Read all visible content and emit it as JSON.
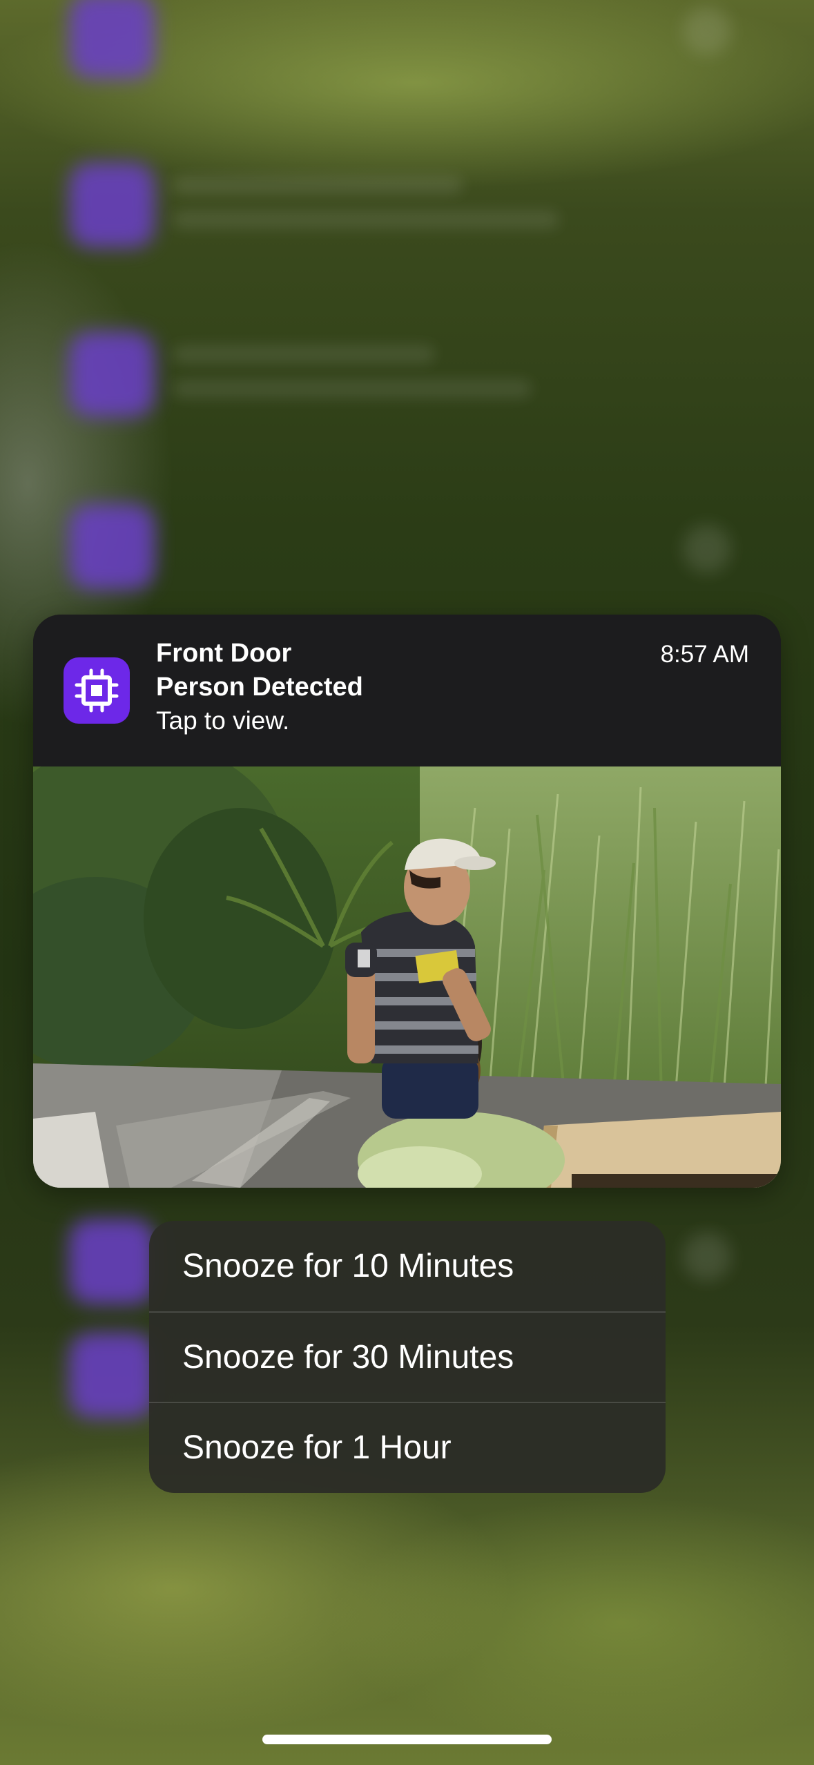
{
  "notification": {
    "title": "Front Door",
    "subtitle": "Person Detected",
    "body": "Tap to view.",
    "time": "8:57 AM",
    "app_icon": "chip-icon",
    "accent_color": "#6d28e8"
  },
  "context_menu": {
    "items": [
      {
        "label": "Snooze for 10 Minutes"
      },
      {
        "label": "Snooze for 30 Minutes"
      },
      {
        "label": "Snooze for 1 Hour"
      }
    ]
  },
  "colors": {
    "notification_bg": "#1c1c1e",
    "menu_bg": "#2c2d26",
    "text": "#ffffff"
  }
}
